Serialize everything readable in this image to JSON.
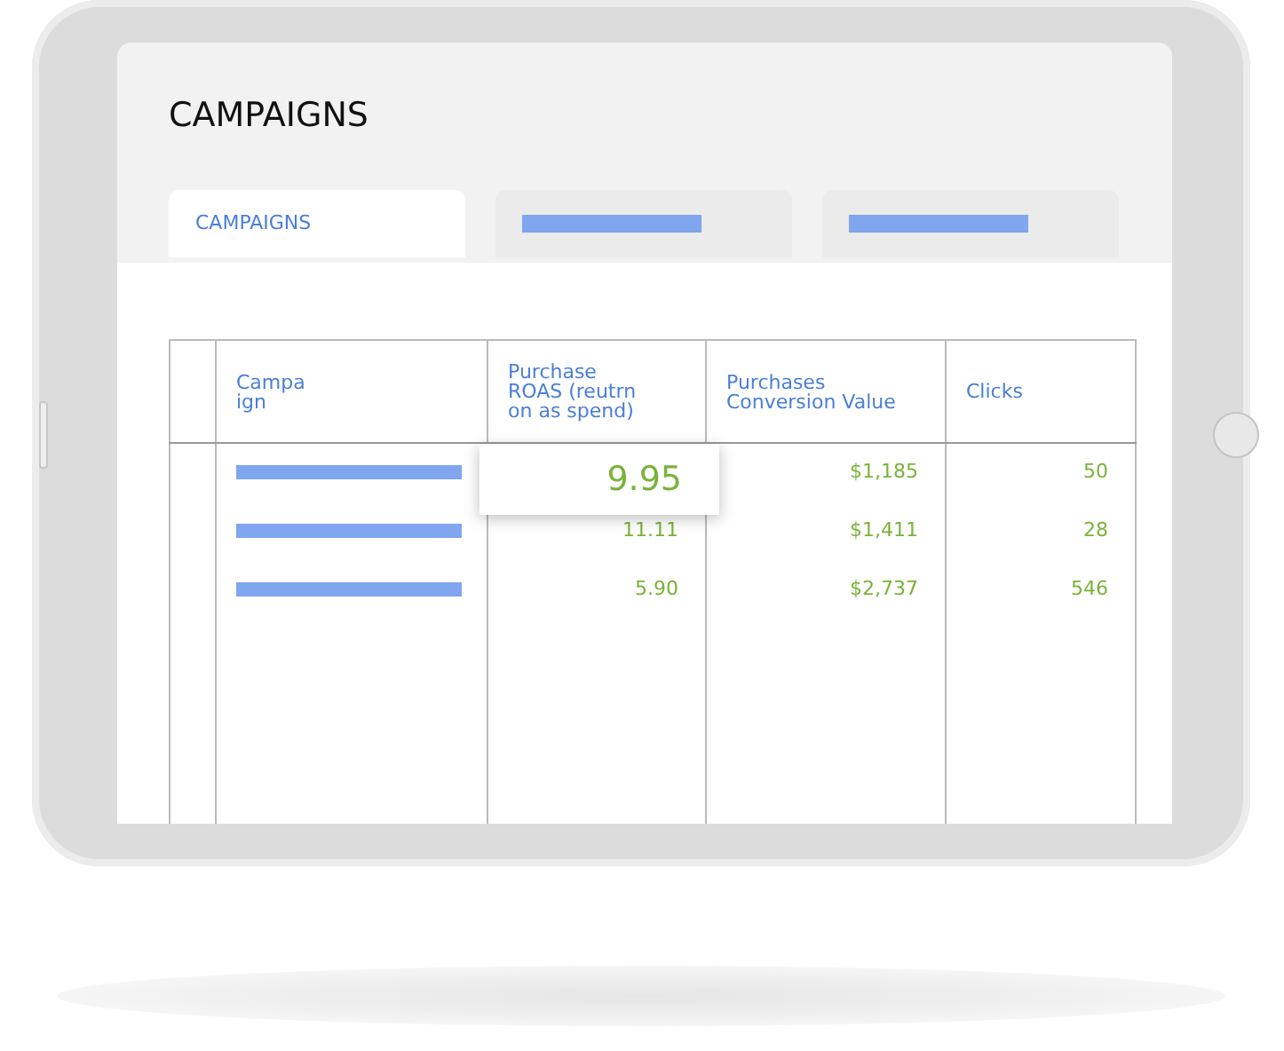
{
  "title": "CAMPAIGNS",
  "tabs": [
    {
      "kind": "label",
      "label": "CAMPAIGNS",
      "selected": true
    },
    {
      "kind": "placeholder",
      "selected": false
    },
    {
      "kind": "placeholder",
      "selected": false
    }
  ],
  "table": {
    "columns": [
      "",
      "Campa\nign",
      "Purchase\nROAS (reutrn\non as spend)",
      "Purchases\nConversion Value",
      "Clicks"
    ],
    "rows": [
      {
        "highlighted": true,
        "purchase_roas": "9.95",
        "conversion_value": "$1,185",
        "clicks": "50"
      },
      {
        "highlighted": false,
        "purchase_roas": "11.11",
        "conversion_value": "$1,411",
        "clicks": "28"
      },
      {
        "highlighted": false,
        "purchase_roas": "5.90",
        "conversion_value": "$2,737",
        "clicks": "546"
      }
    ]
  }
}
